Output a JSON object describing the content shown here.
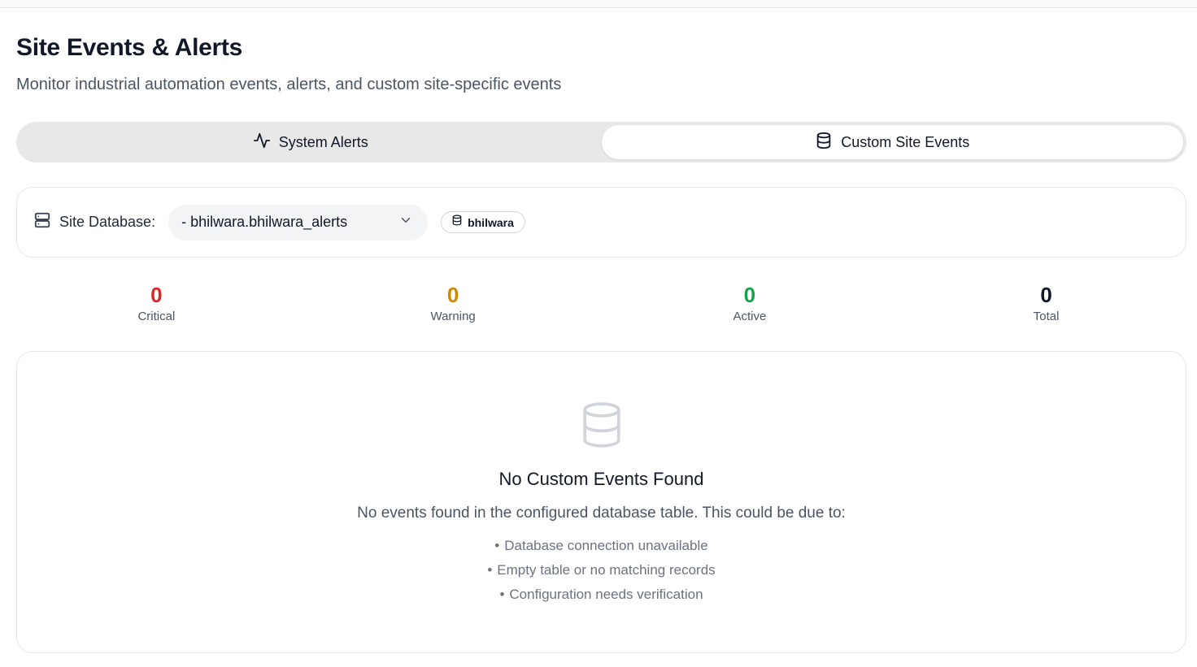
{
  "header": {
    "title": "Site Events & Alerts",
    "subtitle": "Monitor industrial automation events, alerts, and custom site-specific events"
  },
  "tabs": [
    {
      "label": "System Alerts",
      "icon": "activity-icon",
      "active": false
    },
    {
      "label": "Custom Site Events",
      "icon": "database-icon",
      "active": true
    }
  ],
  "site_database": {
    "label": "Site Database:",
    "selected": "- bhilwara.bhilwara_alerts",
    "badge": "bhilwara"
  },
  "stats": [
    {
      "value": "0",
      "label": "Critical",
      "color": "#dc2626"
    },
    {
      "value": "0",
      "label": "Warning",
      "color": "#ca8a04"
    },
    {
      "value": "0",
      "label": "Active",
      "color": "#16a34a"
    },
    {
      "value": "0",
      "label": "Total",
      "color": "#111827"
    }
  ],
  "empty_state": {
    "icon": "database-icon",
    "title": "No Custom Events Found",
    "description": "No events found in the configured database table. This could be due to:",
    "reasons": [
      "Database connection unavailable",
      "Empty table or no matching records",
      "Configuration needs verification"
    ]
  }
}
